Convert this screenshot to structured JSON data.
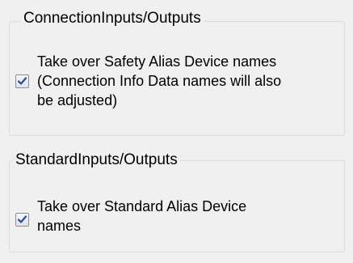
{
  "connection_group": {
    "title": "ConnectionInputs/Outputs",
    "checkbox": {
      "checked": true,
      "label_lines": [
        "Take over Safety Alias Device names",
        "(Connection Info Data names will also",
        "be adjusted)"
      ]
    }
  },
  "standard_group": {
    "title": "StandardInputs/Outputs",
    "checkbox": {
      "checked": true,
      "label_lines": [
        "Take over Standard Alias Device",
        "names"
      ]
    }
  },
  "colors": {
    "background": "#f0f0f0",
    "group_border": "#dcdcdc",
    "check_mark": "#2e4a8c"
  }
}
